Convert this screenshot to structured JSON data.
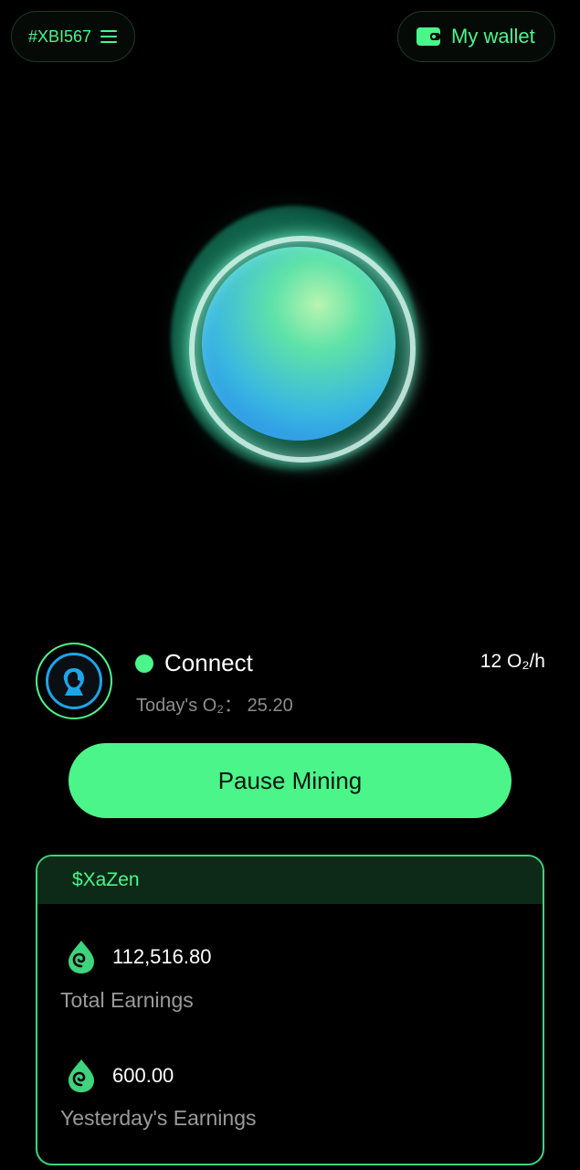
{
  "header": {
    "user_id": "#XBI567",
    "wallet_label": "My wallet"
  },
  "mining": {
    "status": "Connect",
    "today_label": "Today's O₂：",
    "today_value": "25.20",
    "rate": "12 O₂/h",
    "pause_label": "Pause Mining"
  },
  "earnings": {
    "token": "$XaZen",
    "total_value": "112,516.80",
    "total_label": "Total Earnings",
    "yesterday_value": "600.00",
    "yesterday_label": "Yesterday's Earnings"
  },
  "colors": {
    "accent": "#4cf58a",
    "background": "#000000"
  },
  "icons": {
    "menu": "menu-icon",
    "wallet": "wallet-icon",
    "avatar": "user-silhouette-icon",
    "earnings": "swirl-drop-icon"
  }
}
